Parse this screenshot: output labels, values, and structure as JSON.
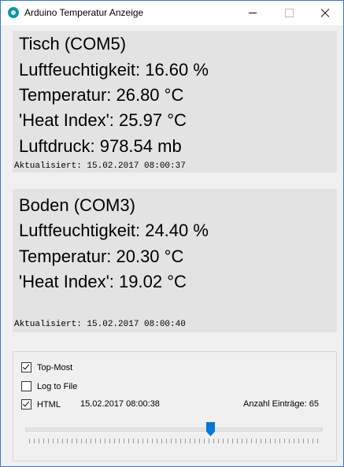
{
  "window": {
    "title": "Arduino Temperatur Anzeige",
    "icon": "arduino-app-icon"
  },
  "panels": [
    {
      "title": "Tisch (COM5)",
      "humidity": "Luftfeuchtigkeit: 16.60 %",
      "temperature": "Temperatur: 26.80 °C",
      "heat_index": "'Heat Index': 25.97 °C",
      "pressure": "Luftdruck: 978.54 mb",
      "updated": "Aktualisiert: 15.02.2017 08:00:37"
    },
    {
      "title": "Boden (COM3)",
      "humidity": "Luftfeuchtigkeit: 24.40 %",
      "temperature": "Temperatur: 20.30 °C",
      "heat_index": "'Heat Index': 19.02 °C",
      "updated": "Aktualisiert: 15.02.2017 08:00:40"
    }
  ],
  "options": {
    "top_most": {
      "label": "Top-Most",
      "checked": true
    },
    "log_to_file": {
      "label": "Log to File",
      "checked": false
    },
    "html": {
      "label": "HTML",
      "checked": true
    }
  },
  "status": {
    "timestamp": "15.02.2017 08:00:38",
    "count_label": "Anzahl Einträge: 65"
  },
  "slider": {
    "value_fraction": 0.63,
    "accent": "#0078d7"
  }
}
